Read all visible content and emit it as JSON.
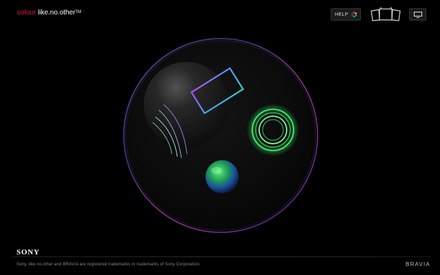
{
  "header": {
    "logo_colour": "colour",
    "logo_rest": " like.no.other",
    "logo_tm": "TM",
    "help_label": "HELP"
  },
  "icons": {
    "help": "color-wheel-icon",
    "devices": "tv-group-icon",
    "display": "monitor-icon"
  },
  "footer": {
    "brand": "SONY",
    "legal": "Sony, like.no.other and BRAVIA are registered trademarks or trademarks of Sony Corporation.",
    "product": "BRAVIA"
  },
  "colors": {
    "background": "#000000",
    "accent": "#e0174c",
    "text": "#ffffff"
  }
}
